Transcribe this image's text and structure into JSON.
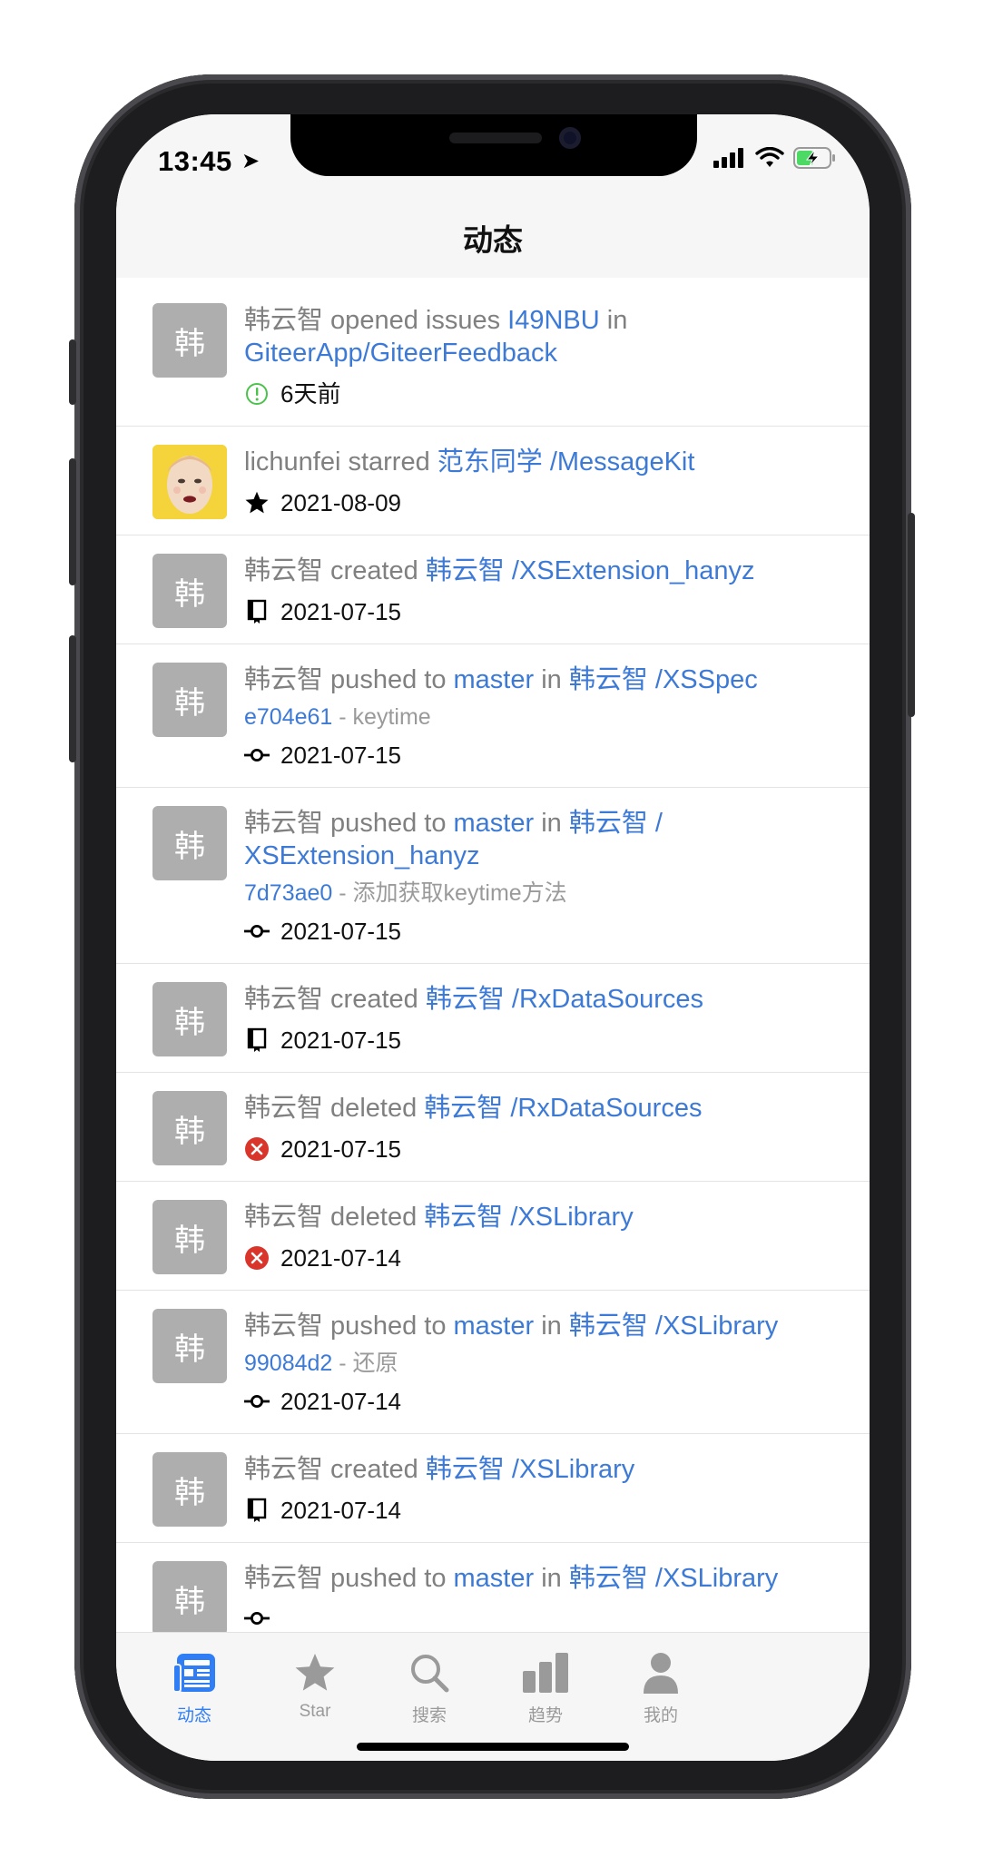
{
  "status_bar": {
    "time": "13:45",
    "location_glyph": "➤"
  },
  "nav": {
    "title": "动态"
  },
  "feed": [
    {
      "avatar": "韩",
      "avatar_type": "text",
      "segments": [
        {
          "t": "韩云智 opened issues ",
          "link": false
        },
        {
          "t": "I49NBU",
          "link": true
        },
        {
          "t": " in ",
          "link": false
        },
        {
          "t": "GiteerApp/GiteerFeedback",
          "link": true
        }
      ],
      "meta_icon": "issue-open-icon",
      "meta": "6天前"
    },
    {
      "avatar": "",
      "avatar_type": "photo",
      "segments": [
        {
          "t": "lichunfei starred ",
          "link": false
        },
        {
          "t": "范东同学 /MessageKit",
          "link": true
        }
      ],
      "meta_icon": "star-icon",
      "meta": "2021-08-09"
    },
    {
      "avatar": "韩",
      "avatar_type": "text",
      "segments": [
        {
          "t": "韩云智 created ",
          "link": false
        },
        {
          "t": "韩云智 /XSExtension_hanyz",
          "link": true
        }
      ],
      "meta_icon": "repo-icon",
      "meta": "2021-07-15"
    },
    {
      "avatar": "韩",
      "avatar_type": "text",
      "segments": [
        {
          "t": "韩云智 pushed to ",
          "link": false
        },
        {
          "t": "master",
          "link": true
        },
        {
          "t": " in ",
          "link": false
        },
        {
          "t": "韩云智 /XSSpec",
          "link": true
        }
      ],
      "commit": {
        "hash": "e704e61",
        "msg": " - keytime"
      },
      "meta_icon": "commit-icon",
      "meta": "2021-07-15"
    },
    {
      "avatar": "韩",
      "avatar_type": "text",
      "segments": [
        {
          "t": "韩云智 pushed to ",
          "link": false
        },
        {
          "t": "master",
          "link": true
        },
        {
          "t": " in ",
          "link": false
        },
        {
          "t": "韩云智 / XSExtension_hanyz",
          "link": true
        }
      ],
      "commit": {
        "hash": "7d73ae0",
        "msg": " - 添加获取keytime方法"
      },
      "meta_icon": "commit-icon",
      "meta": "2021-07-15"
    },
    {
      "avatar": "韩",
      "avatar_type": "text",
      "segments": [
        {
          "t": "韩云智 created ",
          "link": false
        },
        {
          "t": "韩云智 /RxDataSources",
          "link": true
        }
      ],
      "meta_icon": "repo-icon",
      "meta": "2021-07-15"
    },
    {
      "avatar": "韩",
      "avatar_type": "text",
      "segments": [
        {
          "t": "韩云智 deleted ",
          "link": false
        },
        {
          "t": "韩云智 /RxDataSources",
          "link": true
        }
      ],
      "meta_icon": "delete-icon",
      "meta": "2021-07-15"
    },
    {
      "avatar": "韩",
      "avatar_type": "text",
      "segments": [
        {
          "t": "韩云智 deleted ",
          "link": false
        },
        {
          "t": "韩云智 /XSLibrary",
          "link": true
        }
      ],
      "meta_icon": "delete-icon",
      "meta": "2021-07-14"
    },
    {
      "avatar": "韩",
      "avatar_type": "text",
      "segments": [
        {
          "t": "韩云智 pushed to ",
          "link": false
        },
        {
          "t": "master",
          "link": true
        },
        {
          "t": " in ",
          "link": false
        },
        {
          "t": "韩云智 /XSLibrary",
          "link": true
        }
      ],
      "commit": {
        "hash": "99084d2",
        "msg": " - 还原"
      },
      "meta_icon": "commit-icon",
      "meta": "2021-07-14"
    },
    {
      "avatar": "韩",
      "avatar_type": "text",
      "segments": [
        {
          "t": "韩云智 created ",
          "link": false
        },
        {
          "t": "韩云智 /XSLibrary",
          "link": true
        }
      ],
      "meta_icon": "repo-icon",
      "meta": "2021-07-14"
    },
    {
      "avatar": "韩",
      "avatar_type": "text",
      "segments": [
        {
          "t": "韩云智 pushed to ",
          "link": false
        },
        {
          "t": "master",
          "link": true
        },
        {
          "t": " in ",
          "link": false
        },
        {
          "t": "韩云智 /XSLibrary",
          "link": true
        }
      ],
      "meta_icon": "commit-icon",
      "meta": ""
    }
  ],
  "tabs": [
    {
      "label": "动态",
      "icon": "feed-icon",
      "active": true
    },
    {
      "label": "Star",
      "icon": "star-icon",
      "active": false
    },
    {
      "label": "搜索",
      "icon": "search-icon",
      "active": false
    },
    {
      "label": "趋势",
      "icon": "chart-icon",
      "active": false
    },
    {
      "label": "我的",
      "icon": "person-icon",
      "active": false
    }
  ],
  "colors": {
    "link": "#3d7ad6",
    "accent": "#2f7ef6",
    "delete": "#d9352b",
    "issue_open": "#4cc24c",
    "avatar_bg": "#aeaeae"
  }
}
